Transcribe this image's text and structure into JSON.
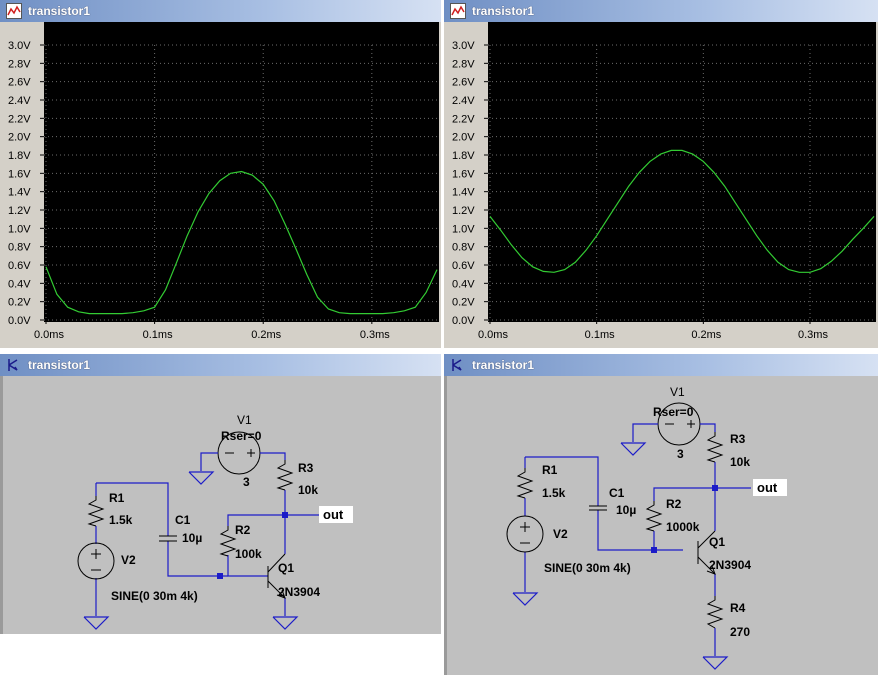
{
  "windows": {
    "plot_left": {
      "title": "transistor1"
    },
    "plot_right": {
      "title": "transistor1"
    },
    "sch_left": {
      "title": "transistor1"
    },
    "sch_right": {
      "title": "transistor1"
    }
  },
  "colors": {
    "plot_bg": "#000000",
    "trace": "#33cc33",
    "grid": "#6b6b6b",
    "wire": "#1c1cc8",
    "schematic_bg": "#c0c0c0",
    "title_bar": "#7b96cc"
  },
  "icons": {
    "plot_window": "waveform-icon",
    "schematic_window": "schematic-icon"
  },
  "chart_data": [
    {
      "type": "line",
      "y_ticks": [
        "3.0V",
        "2.8V",
        "2.6V",
        "2.4V",
        "2.2V",
        "2.0V",
        "1.8V",
        "1.6V",
        "1.4V",
        "1.2V",
        "1.0V",
        "0.8V",
        "0.6V",
        "0.4V",
        "0.2V",
        "0.0V"
      ],
      "x_ticks": [
        "0.0ms",
        "0.1ms",
        "0.2ms",
        "0.3ms"
      ],
      "ylim": [
        0,
        3.0
      ],
      "xlim": [
        0,
        0.36
      ],
      "grid": true,
      "series": [
        {
          "x": [
            0,
            0.01,
            0.02,
            0.03,
            0.04,
            0.05,
            0.06,
            0.07,
            0.08,
            0.09,
            0.1,
            0.11,
            0.12,
            0.13,
            0.14,
            0.15,
            0.16,
            0.17,
            0.18,
            0.19,
            0.2,
            0.21,
            0.22,
            0.23,
            0.24,
            0.25,
            0.26,
            0.27,
            0.28,
            0.29,
            0.3,
            0.31,
            0.32,
            0.33,
            0.34,
            0.35,
            0.36
          ],
          "y": [
            0.58,
            0.28,
            0.14,
            0.09,
            0.07,
            0.07,
            0.07,
            0.07,
            0.08,
            0.1,
            0.14,
            0.33,
            0.62,
            0.92,
            1.18,
            1.38,
            1.52,
            1.6,
            1.62,
            1.58,
            1.48,
            1.3,
            1.05,
            0.78,
            0.5,
            0.25,
            0.12,
            0.08,
            0.07,
            0.07,
            0.07,
            0.07,
            0.08,
            0.1,
            0.14,
            0.3,
            0.55
          ]
        }
      ]
    },
    {
      "type": "line",
      "y_ticks": [
        "3.0V",
        "2.8V",
        "2.6V",
        "2.4V",
        "2.2V",
        "2.0V",
        "1.8V",
        "1.6V",
        "1.4V",
        "1.2V",
        "1.0V",
        "0.8V",
        "0.6V",
        "0.4V",
        "0.2V",
        "0.0V"
      ],
      "x_ticks": [
        "0.0ms",
        "0.1ms",
        "0.2ms",
        "0.3ms"
      ],
      "ylim": [
        0,
        3.0
      ],
      "xlim": [
        0,
        0.36
      ],
      "grid": true,
      "series": [
        {
          "x": [
            0,
            0.01,
            0.02,
            0.03,
            0.04,
            0.05,
            0.06,
            0.07,
            0.08,
            0.09,
            0.1,
            0.11,
            0.12,
            0.13,
            0.14,
            0.15,
            0.16,
            0.17,
            0.18,
            0.19,
            0.2,
            0.21,
            0.22,
            0.23,
            0.24,
            0.25,
            0.26,
            0.27,
            0.28,
            0.29,
            0.3,
            0.31,
            0.32,
            0.33,
            0.34,
            0.35,
            0.36
          ],
          "y": [
            1.13,
            0.98,
            0.82,
            0.68,
            0.58,
            0.53,
            0.52,
            0.55,
            0.63,
            0.76,
            0.92,
            1.1,
            1.28,
            1.46,
            1.61,
            1.73,
            1.81,
            1.85,
            1.85,
            1.81,
            1.73,
            1.61,
            1.46,
            1.28,
            1.1,
            0.92,
            0.76,
            0.63,
            0.55,
            0.52,
            0.52,
            0.56,
            0.64,
            0.75,
            0.88,
            1.0,
            1.13
          ]
        }
      ]
    }
  ],
  "schematic_left": {
    "v1": {
      "name": "V1",
      "param": "Rser=0",
      "value": "3"
    },
    "r1": {
      "name": "R1",
      "value": "1.5k"
    },
    "r2": {
      "name": "R2",
      "value": "100k"
    },
    "r3": {
      "name": "R3",
      "value": "10k"
    },
    "c1": {
      "name": "C1",
      "value": "10µ"
    },
    "v2": {
      "name": "V2",
      "value": "SINE(0 30m 4k)"
    },
    "q1": {
      "name": "Q1",
      "model": "2N3904"
    },
    "net_out": "out"
  },
  "schematic_right": {
    "v1": {
      "name": "V1",
      "param": "Rser=0",
      "value": "3"
    },
    "r1": {
      "name": "R1",
      "value": "1.5k"
    },
    "r2": {
      "name": "R2",
      "value": "1000k"
    },
    "r3": {
      "name": "R3",
      "value": "10k"
    },
    "r4": {
      "name": "R4",
      "value": "270"
    },
    "c1": {
      "name": "C1",
      "value": "10µ"
    },
    "v2": {
      "name": "V2",
      "value": "SINE(0 30m 4k)"
    },
    "q1": {
      "name": "Q1",
      "model": "2N3904"
    },
    "net_out": "out"
  }
}
